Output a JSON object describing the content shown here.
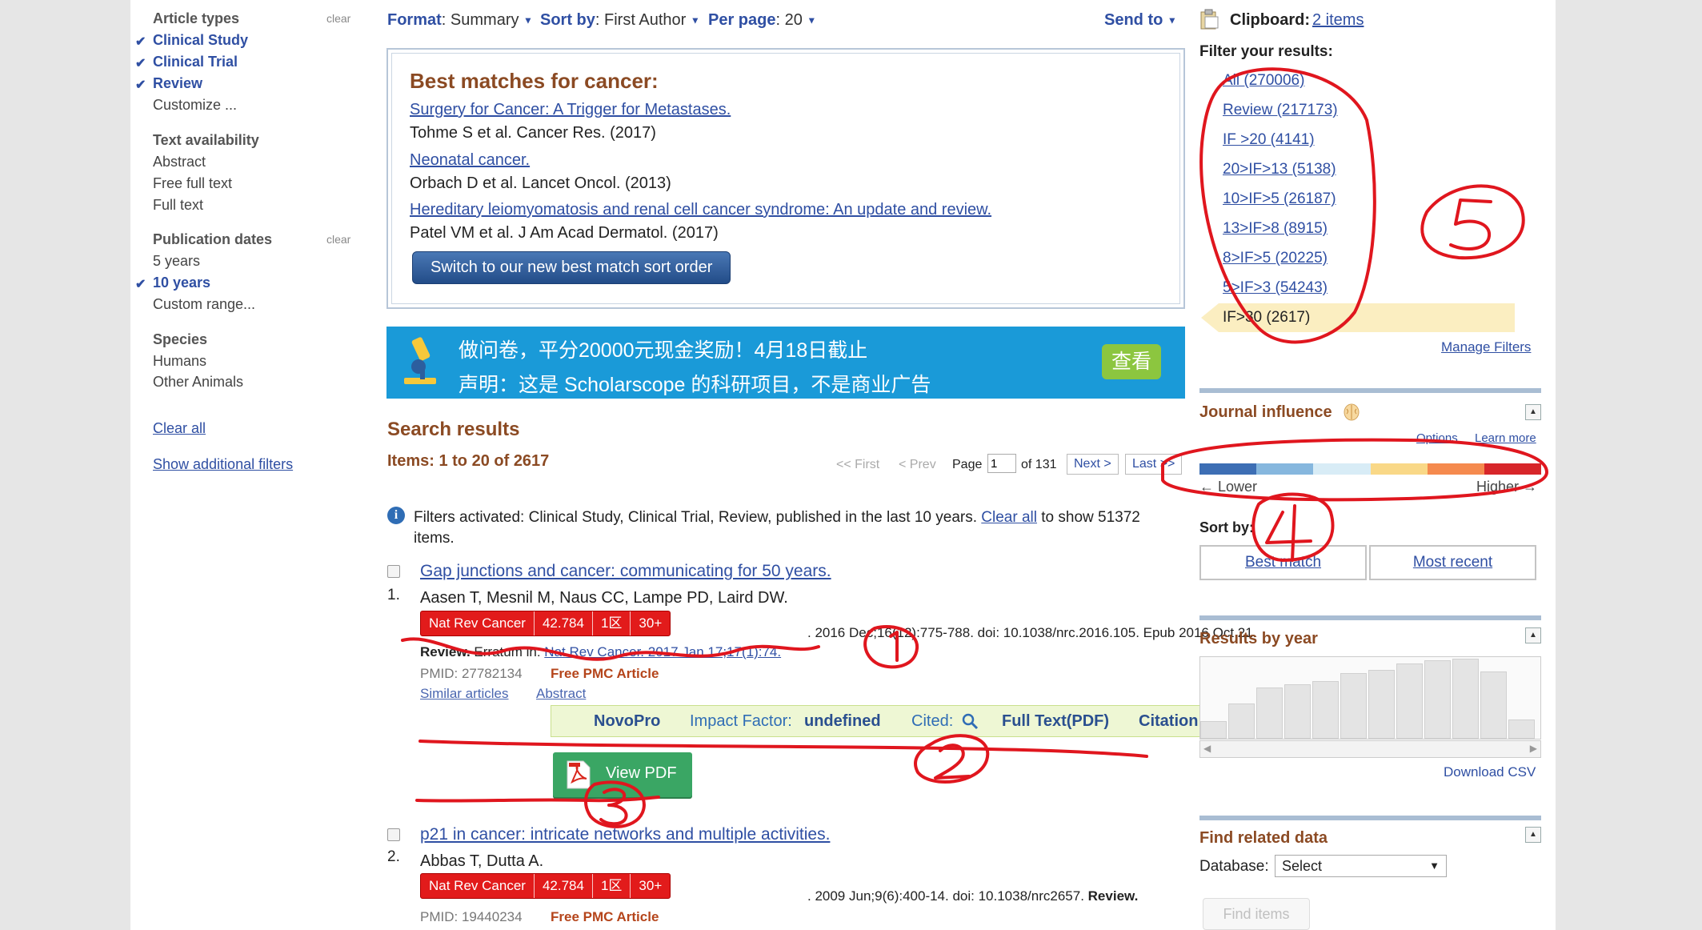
{
  "left_filters": {
    "article_types": {
      "heading": "Article types",
      "clear": "clear",
      "items": [
        "Clinical Study",
        "Clinical Trial",
        "Review",
        "Customize ..."
      ]
    },
    "text_availability": {
      "heading": "Text availability",
      "items": [
        "Abstract",
        "Free full text",
        "Full text"
      ]
    },
    "publication_dates": {
      "heading": "Publication dates",
      "clear": "clear",
      "items": [
        "5 years",
        "10 years",
        "Custom range..."
      ]
    },
    "species": {
      "heading": "Species",
      "items": [
        "Humans",
        "Other Animals"
      ]
    },
    "clear_all": "Clear all",
    "show_additional": "Show additional filters"
  },
  "toolbar": {
    "format_label": "Format",
    "format_value": ": Summary",
    "sort_label": "Sort by",
    "sort_value": ": First Author",
    "perpage_label": "Per page",
    "perpage_value": ": 20",
    "send_to": "Send to"
  },
  "best_matches": {
    "title": "Best matches for cancer:",
    "items": [
      {
        "title": "Surgery for Cancer: A Trigger for Metastases.",
        "meta": "Tohme S et al. Cancer Res. (2017)"
      },
      {
        "title": "Neonatal cancer.",
        "meta": "Orbach D et al. Lancet Oncol. (2013)"
      },
      {
        "title": "Hereditary leiomyomatosis and renal cell cancer syndrome: An update and review.",
        "meta": "Patel VM et al. J Am Acad Dermatol. (2017)"
      }
    ],
    "switch_button": "Switch to our new best match sort order"
  },
  "ad_banner": {
    "line1": "做问卷，平分20000元现金奖励！4月18日截止",
    "line2": "声明：这是 Scholarscope 的科研项目，不是商业广告",
    "button": "查看"
  },
  "search_results": {
    "heading": "Search results",
    "items_count": "Items: 1 to 20 of 2617",
    "pager": {
      "first": "<< First",
      "prev": "< Prev",
      "page_label": "Page",
      "page_value": "1",
      "of": "of 131",
      "next": "Next >",
      "last": "Last >>"
    },
    "filter_note": "Filters activated: Clinical Study, Clinical Trial, Review, published in the last 10 years.",
    "filter_clear": "Clear all",
    "filter_note_end": "to show 51372 items.",
    "results": [
      {
        "num": "1.",
        "title": "Gap junctions and cancer: communicating for 50 years.",
        "authors": "Aasen T, Mesnil M, Naus CC, Lampe PD, Laird DW.",
        "badge": {
          "journal": "Nat Rev Cancer",
          "if": "42.784",
          "zone": "1区",
          "cited": "30+"
        },
        "citation": ". 2016 Dec;16(12):775-788. doi: 10.1038/nrc.2016.105. Epub 2016 Oct 21.",
        "line2_bold": "Review.",
        "line2_text": "Erratum in:",
        "line2_link": "Nat Rev Cancer. 2017 Jan 17;17(1):74.",
        "pmid": "PMID: 27782134",
        "free_pmc": "Free PMC Article",
        "similar": "Similar articles",
        "abstract": "Abstract"
      },
      {
        "num": "2.",
        "title": "p21 in cancer: intricate networks and multiple activities.",
        "authors": "Abbas T, Dutta A.",
        "badge": {
          "journal": "Nat Rev Cancer",
          "if": "42.784",
          "zone": "1区",
          "cited": "30+"
        },
        "citation": ". 2009 Jun;9(6):400-14. doi: 10.1038/nrc2657.",
        "citation_bold": "Review.",
        "pmid": "PMID: 19440234",
        "free_pmc": "Free PMC Article"
      }
    ],
    "novopro_bar": {
      "novopro": "NovoPro",
      "if_label": "Impact Factor:",
      "if_value": "undefined",
      "cited": "Cited:",
      "fulltext": "Full Text(PDF)",
      "citation": "Citation"
    },
    "view_pdf": "View PDF"
  },
  "right_column": {
    "clipboard_label": "Clipboard:",
    "clipboard_link": "2 items",
    "filter_heading": "Filter your results:",
    "filters": [
      "All (270006)",
      "Review (217173)",
      "IF >20 (4141)",
      "20>IF>13 (5138)",
      "10>IF>5 (26187)",
      "13>IF>8 (8915)",
      "8>IF>5 (20225)",
      "5>IF>3 (54243)",
      "IF>30 (2617)"
    ],
    "manage_filters": "Manage Filters",
    "journal_influence": {
      "heading": "Journal influence",
      "options": "Options",
      "learn_more": "Learn more",
      "lower": "← Lower",
      "higher": "Higher →",
      "scale_colors": [
        "#3d6eb4",
        "#86b7de",
        "#d8ecf6",
        "#f9d887",
        "#f58a4e",
        "#d7262a"
      ],
      "sort_by": "Sort by:",
      "best_match": "Best match",
      "most_recent": "Most recent"
    },
    "results_by_year": {
      "heading": "Results by year",
      "download_csv": "Download CSV"
    },
    "find_related": {
      "heading": "Find related data",
      "database_label": "Database:",
      "select_value": "Select",
      "find_items": "Find items"
    }
  },
  "annotations": {
    "num1": "1",
    "num2": "2",
    "num3": "3",
    "num4": "4",
    "num5": "5",
    "color": "#e0161e"
  }
}
